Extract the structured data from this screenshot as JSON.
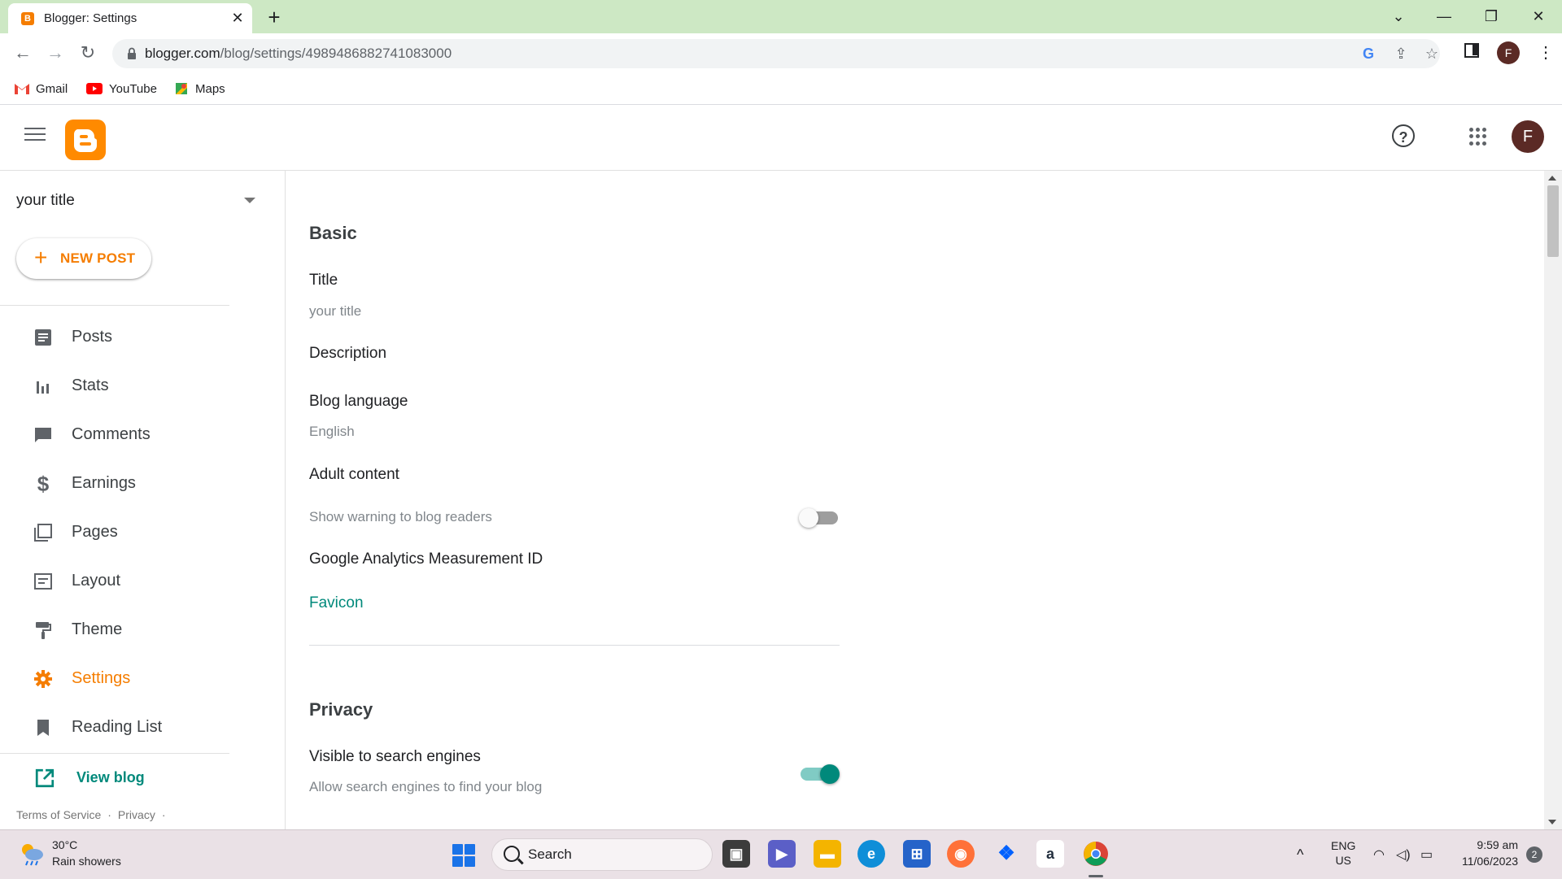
{
  "browser": {
    "tab_title": "Blogger: Settings",
    "url_host": "blogger.com",
    "url_path": "/blog/settings/4989486882741083000",
    "profile_initial": "F",
    "bookmarks": [
      {
        "label": "Gmail",
        "icon": "gmail-icon"
      },
      {
        "label": "YouTube",
        "icon": "youtube-icon"
      },
      {
        "label": "Maps",
        "icon": "maps-icon"
      }
    ]
  },
  "header": {
    "avatar_initial": "F",
    "help_glyph": "?"
  },
  "sidebar": {
    "blog_title": "your title",
    "new_post_label": "NEW POST",
    "items": [
      {
        "label": "Posts",
        "icon": "posts-icon"
      },
      {
        "label": "Stats",
        "icon": "stats-icon"
      },
      {
        "label": "Comments",
        "icon": "comments-icon"
      },
      {
        "label": "Earnings",
        "icon": "earnings-icon"
      },
      {
        "label": "Pages",
        "icon": "pages-icon"
      },
      {
        "label": "Layout",
        "icon": "layout-icon"
      },
      {
        "label": "Theme",
        "icon": "theme-icon"
      },
      {
        "label": "Settings",
        "icon": "gear-icon",
        "active": true
      },
      {
        "label": "Reading List",
        "icon": "bookmark-icon"
      }
    ],
    "view_blog_label": "View blog",
    "footer": {
      "terms": "Terms of Service",
      "privacy": "Privacy",
      "sep": "·"
    }
  },
  "main": {
    "basic_title": "Basic",
    "title_label": "Title",
    "title_value": "your title",
    "description_label": "Description",
    "language_label": "Blog language",
    "language_value": "English",
    "adult_label": "Adult content",
    "adult_sub": "Show warning to blog readers",
    "adult_toggle_on": false,
    "analytics_label": "Google Analytics Measurement ID",
    "favicon_label": "Favicon",
    "privacy_title": "Privacy",
    "visible_label": "Visible to search engines",
    "visible_sub": "Allow search engines to find your blog",
    "visible_toggle_on": true
  },
  "colors": {
    "accent": "#f57d00",
    "teal": "#00897b",
    "toggle_on_track": "#80cbc4",
    "toggle_on_thumb": "#00897b"
  },
  "taskbar": {
    "weather_temp": "30°C",
    "weather_desc": "Rain showers",
    "search_label": "Search",
    "lang_line1": "ENG",
    "lang_line2": "US",
    "time": "9:59 am",
    "date": "11/06/2023",
    "notifications": "2"
  }
}
